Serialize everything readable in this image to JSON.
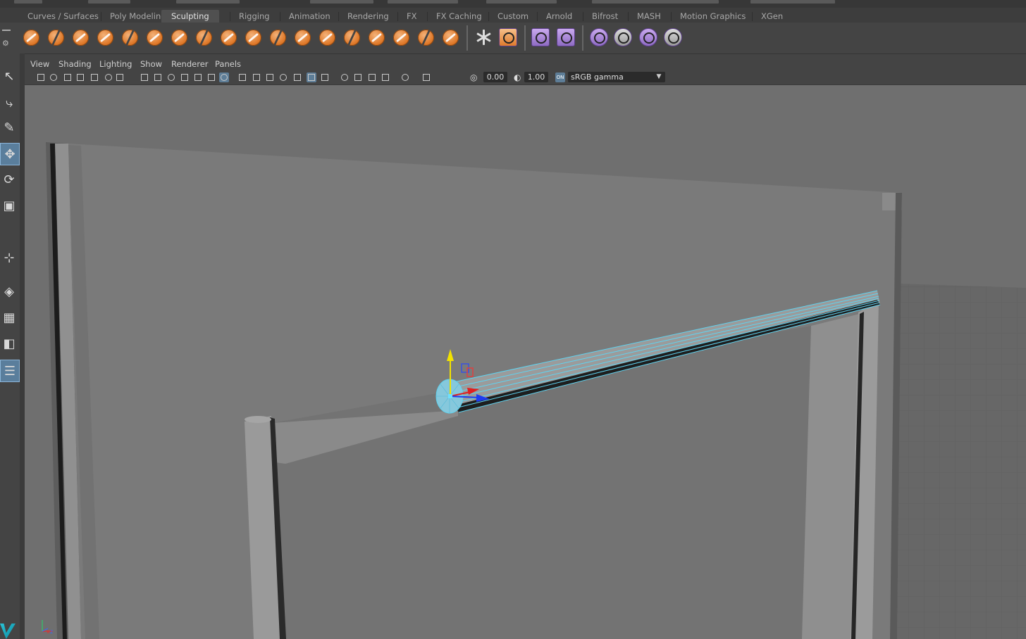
{
  "shelf_tabs": [
    "Curves / Surfaces",
    "Poly Modeling",
    "Sculpting",
    "Rigging",
    "Animation",
    "Rendering",
    "FX",
    "FX Caching",
    "Custom",
    "Arnold",
    "Bifrost",
    "MASH",
    "Motion Graphics",
    "XGen"
  ],
  "active_tab": "Sculpting",
  "shelf_icons": {
    "sculpt": [
      "sculpt-tool-icon",
      "smooth-tool-icon",
      "relax-tool-icon",
      "grab-tool-icon",
      "pinch-tool-icon",
      "flatten-tool-icon",
      "foamy-tool-icon",
      "spray-tool-icon",
      "repeat-tool-icon",
      "imprint-tool-icon",
      "wax-tool-icon",
      "scrape-tool-icon",
      "fill-tool-icon",
      "knife-tool-icon",
      "smear-tool-icon",
      "bulge-tool-icon",
      "amplify-tool-icon",
      "freeze-tool-icon"
    ],
    "utility": [
      "convert-to-frozen-icon",
      "sculpt-layers-icon"
    ],
    "blend": [
      "blend-shape-icon",
      "pose-editor-icon"
    ],
    "mesh": [
      "mesh-display-icon",
      "transfer-attributes-icon",
      "uv-set-icon",
      "clear-sculpt-icon"
    ]
  },
  "panel_menu": [
    "View",
    "Shading",
    "Lighting",
    "Show",
    "Renderer",
    "Panels"
  ],
  "panel_toolbar": {
    "exposure_value": "0.00",
    "gamma_value": "1.00",
    "color_space": "sRGB gamma"
  },
  "toolbox": [
    "select-tool-icon",
    "lasso-tool-icon",
    "paint-select-tool-icon",
    "move-tool-icon",
    "rotate-tool-icon",
    "scale-tool-icon",
    "show-manipulator-icon",
    "single-perspective-layout-icon",
    "four-view-layout-icon",
    "persp-graph-layout-icon",
    "outliner-layout-icon"
  ],
  "colors": {
    "shelf_accent": "#e07b2c",
    "shelf_purple": "#a887d6",
    "selection_wire": "#5fd3f0",
    "viewport_bg": "#6f6f6f",
    "manip_x": "#e02020",
    "manip_y": "#f2e200",
    "manip_z": "#1e3cf0"
  },
  "axis_labels": {
    "x": "x",
    "z": "z"
  }
}
